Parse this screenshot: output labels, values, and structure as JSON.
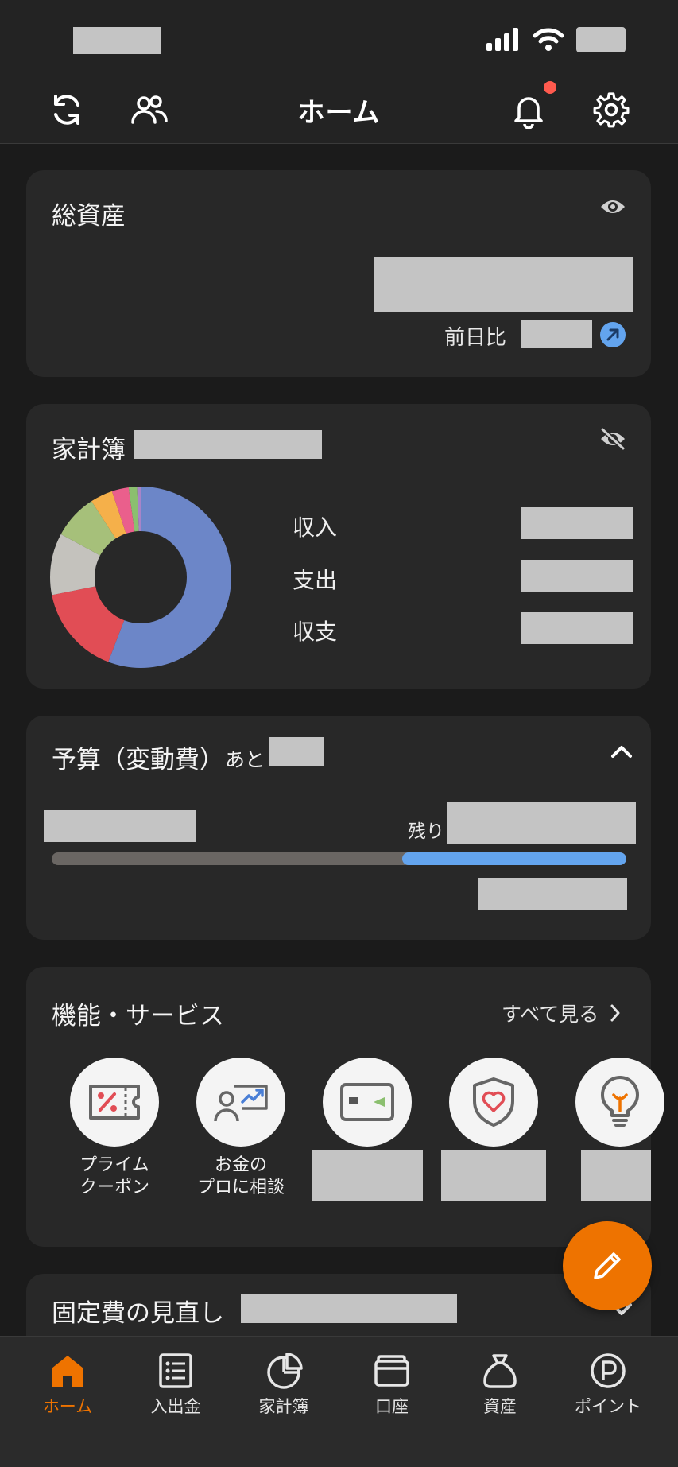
{
  "header": {
    "title": "ホーム"
  },
  "total_assets": {
    "title": "総資産",
    "compare_label": "前日比"
  },
  "household": {
    "title": "家計簿",
    "rows": [
      {
        "label": "収入"
      },
      {
        "label": "支出"
      },
      {
        "label": "収支"
      }
    ]
  },
  "budget": {
    "title": "予算（変動費）",
    "suffix": "あと",
    "remaining_label": "残り",
    "progress_fraction": 0.39
  },
  "services": {
    "title": "機能・サービス",
    "see_all": "すべて見る",
    "items": [
      {
        "label": "プライム\nクーポン",
        "icon": "coupon-icon"
      },
      {
        "label": "お金の\nプロに相談",
        "icon": "consult-icon"
      },
      {
        "icon": "card-icon"
      },
      {
        "icon": "insurance-icon"
      },
      {
        "icon": "lightbulb-icon"
      }
    ]
  },
  "fixed_costs": {
    "title": "固定費の見直し"
  },
  "tabs": [
    {
      "label": "ホーム",
      "icon": "home-icon",
      "active": true
    },
    {
      "label": "入出金",
      "icon": "list-icon"
    },
    {
      "label": "家計簿",
      "icon": "pie-chart-icon"
    },
    {
      "label": "口座",
      "icon": "wallet-icon"
    },
    {
      "label": "資産",
      "icon": "money-bag-icon"
    },
    {
      "label": "ポイント",
      "icon": "point-icon"
    }
  ],
  "colors": {
    "accent": "#ee7300",
    "progress": "#63a4ee",
    "notification": "#ff5a4e"
  }
}
